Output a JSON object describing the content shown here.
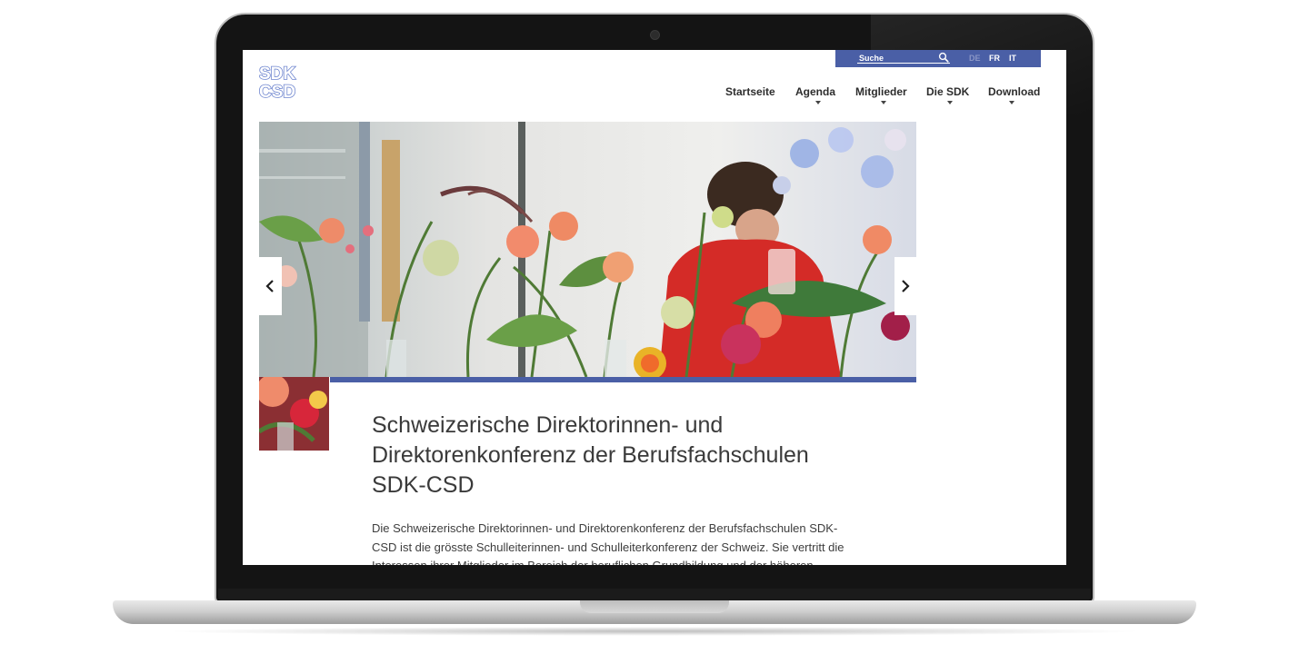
{
  "utility": {
    "search_placeholder": "Suche",
    "languages": [
      {
        "code": "DE",
        "active": true
      },
      {
        "code": "FR",
        "active": false
      },
      {
        "code": "IT",
        "active": false
      }
    ]
  },
  "logo": {
    "line1": "SDK",
    "line2": "CSD"
  },
  "nav": {
    "items": [
      {
        "label": "Startseite",
        "has_dropdown": false
      },
      {
        "label": "Agenda",
        "has_dropdown": true
      },
      {
        "label": "Mitglieder",
        "has_dropdown": true
      },
      {
        "label": "Die SDK",
        "has_dropdown": true
      },
      {
        "label": "Download",
        "has_dropdown": true
      }
    ]
  },
  "hero": {
    "image_description_icon": "hero-photo-flowers",
    "prev_icon": "chevron-left-icon",
    "next_icon": "chevron-right-icon"
  },
  "main": {
    "title": "Schweizerische Direktorinnen- und Direktorenkonferenz der Berufsfachschulen SDK-CSD",
    "intro": "Die Schweizerische Direktorinnen- und Direktorenkonferenz der Berufsfachschulen SDK-CSD ist die grösste Schulleiterinnen- und Schulleiterkonferenz der Schweiz. Sie vertritt die Interessen ihrer Mitglieder im Bereich der beruflichen Grundbildung und der höheren"
  },
  "colors": {
    "brand_blue": "#4a5fa6",
    "logo_blue": "#6f86cf",
    "text_dark": "#2d2d2d"
  }
}
